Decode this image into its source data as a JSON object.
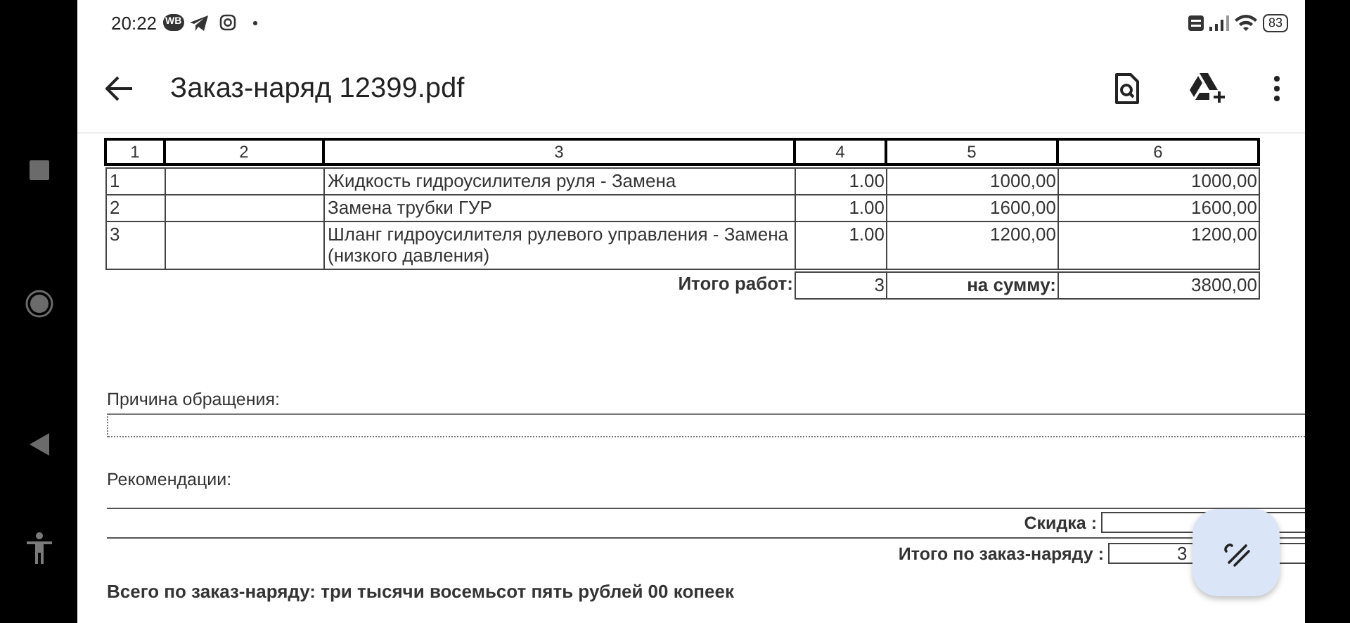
{
  "status_bar": {
    "time": "20:22",
    "badge": "WB",
    "battery": "83"
  },
  "app_bar": {
    "title": "Заказ-наряд 12399.pdf"
  },
  "table": {
    "columns": [
      "1",
      "2",
      "3",
      "4",
      "5",
      "6"
    ],
    "rows": [
      {
        "number": "1",
        "name": "Жидкость гидроусилителя руля - Замена",
        "quantity": "1.00",
        "price": "1000,00",
        "amount": "1000,00"
      },
      {
        "number": "2",
        "name": "Замена трубки ГУР",
        "quantity": "1.00",
        "price": "1600,00",
        "amount": "1600,00"
      },
      {
        "number": "3",
        "name": "Шланг гидроусилителя рулевого управления - Замена (низкого давления)",
        "quantity": "1.00",
        "price": "1200,00",
        "amount": "1200,00"
      }
    ],
    "totals": {
      "label": "Итого работ:",
      "count": "3",
      "sum_label": "на сумму:",
      "sum": "3800,00"
    }
  },
  "reason": {
    "label": "Причина обращения:"
  },
  "recommendations": {
    "label": "Рекомендации:"
  },
  "discount": {
    "label": "Скидка :"
  },
  "order_total": {
    "label": "Итого по заказ-наряду :",
    "value": "3"
  },
  "total_in_words": "Всего по заказ-наряду: три тысячи восемьсот пять рублей 00 копеек"
}
